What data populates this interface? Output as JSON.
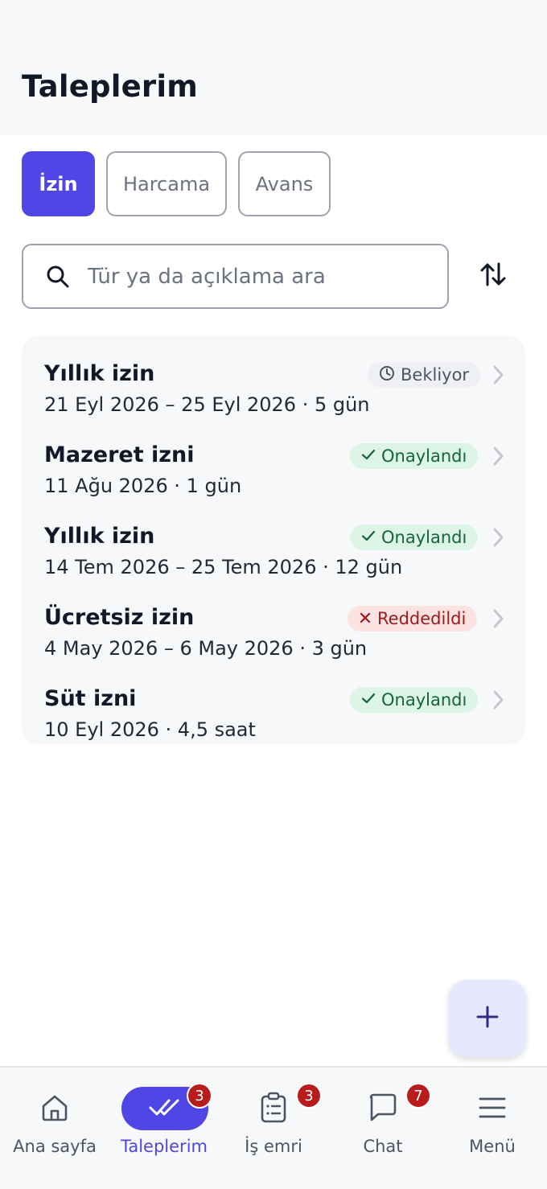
{
  "header": {
    "title": "Taleplerim"
  },
  "tabs": [
    {
      "label": "İzin",
      "active": true
    },
    {
      "label": "Harcama",
      "active": false
    },
    {
      "label": "Avans",
      "active": false
    }
  ],
  "search": {
    "placeholder": "Tür ya da açıklama ara",
    "value": "",
    "icon": "search-icon"
  },
  "sort": {
    "icon": "sort-arrows-icon"
  },
  "requests": [
    {
      "title": "Yıllık izin",
      "subtitle": "21 Eyl 2026 – 25 Eyl 2026 · 5 gün",
      "status": "Bekliyor",
      "status_type": "pending"
    },
    {
      "title": "Mazeret izni",
      "subtitle": "11 Ağu 2026 · 1 gün",
      "status": "Onaylandı",
      "status_type": "approved"
    },
    {
      "title": "Yıllık izin",
      "subtitle": "14 Tem 2026 – 25 Tem 2026 · 12 gün",
      "status": "Onaylandı",
      "status_type": "approved"
    },
    {
      "title": "Ücretsiz izin",
      "subtitle": "4 May 2026 – 6 May 2026 · 3 gün",
      "status": "Reddedildi",
      "status_type": "rejected"
    },
    {
      "title": "Süt izni",
      "subtitle": "10 Eyl 2026 · 4,5 saat",
      "status": "Onaylandı",
      "status_type": "approved"
    }
  ],
  "fab": {
    "icon": "plus-icon"
  },
  "nav": {
    "home": {
      "label": "Ana sayfa",
      "icon": "home-icon"
    },
    "requests": {
      "label": "Taleplerim",
      "icon": "double-check-icon",
      "badge": "3",
      "active": true
    },
    "work_orders": {
      "label": "İş emri",
      "icon": "clipboard-icon",
      "badge": "3"
    },
    "chat": {
      "label": "Chat",
      "icon": "chat-bubble-icon",
      "badge": "7"
    },
    "menu": {
      "label": "Menü",
      "icon": "hamburger-menu-icon"
    }
  },
  "colors": {
    "accent": "#4f46e5",
    "approved_bg": "#dcf5e7",
    "approved_text": "#166534",
    "rejected_bg": "#fde2e2",
    "rejected_text": "#991b1b",
    "pending_bg": "#eef0f3",
    "badge_red": "#b91c1c"
  }
}
